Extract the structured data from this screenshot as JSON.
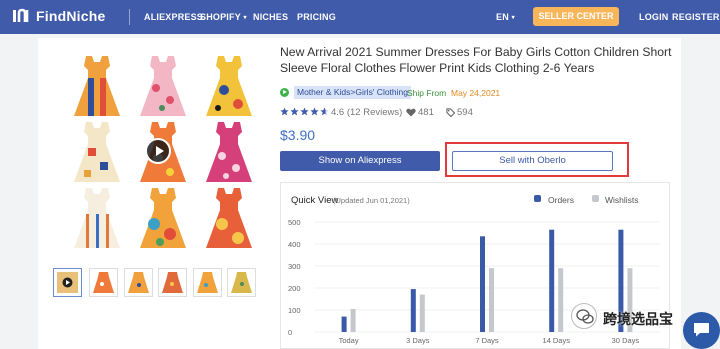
{
  "header": {
    "logo_text": "FindNiche",
    "nav": [
      "ALIEXPRESS",
      "SHOPIFY",
      "NICHES",
      "PRICING"
    ],
    "language": "EN",
    "seller_center_label": "SELLER CENTER",
    "login_label": "LOGIN",
    "register_label": "REGISTER",
    "bg_color": "#3f5ba9",
    "accent_color": "#f7b65a"
  },
  "product": {
    "title": "New Arrival 2021 Summer Dresses For Baby Girls Cotton Children Short Sleeve Floral Clothes Flower Print Kids Clothing 2-6 Years",
    "category": "Mother & Kids>Girls' Clothing",
    "ship_from_label": "Ship From",
    "ship_date": "May 24,2021",
    "rating": 4.6,
    "rating_display": "4.6",
    "reviews_text": "(12 Reviews)",
    "wishlists": "481",
    "tags": "594",
    "price": "$3.90",
    "show_button_label": "Show on Aliexpress",
    "oberlo_button_label": "Sell with Oberlo",
    "main_image_icon": "video-play-icon",
    "thumbnails": [
      "dress-thumb-video",
      "dress-thumb",
      "dress-thumb",
      "dress-thumb",
      "dress-thumb",
      "dress-thumb"
    ]
  },
  "quick_view": {
    "title": "Quick View",
    "updated": "(Updated Jun 01,2021)",
    "legend": [
      {
        "label": "Orders",
        "color": "#3a5aa8"
      },
      {
        "label": "Wishlists",
        "color": "#c4c7cc"
      }
    ]
  },
  "chart_data": {
    "type": "bar",
    "categories": [
      "Today",
      "3 Days",
      "7 Days",
      "14 Days",
      "30 Days"
    ],
    "series": [
      {
        "name": "Orders",
        "values": [
          70,
          195,
          435,
          465,
          465
        ]
      },
      {
        "name": "Wishlists",
        "values": [
          105,
          170,
          290,
          290,
          290
        ]
      }
    ],
    "yticks": [
      0,
      100,
      200,
      300,
      400,
      500
    ],
    "ylim": [
      0,
      500
    ],
    "grid": true
  },
  "watermark": {
    "text": "跨境选品宝",
    "icon": "wechat-icon"
  },
  "chat": {
    "icon": "chat-icon"
  }
}
